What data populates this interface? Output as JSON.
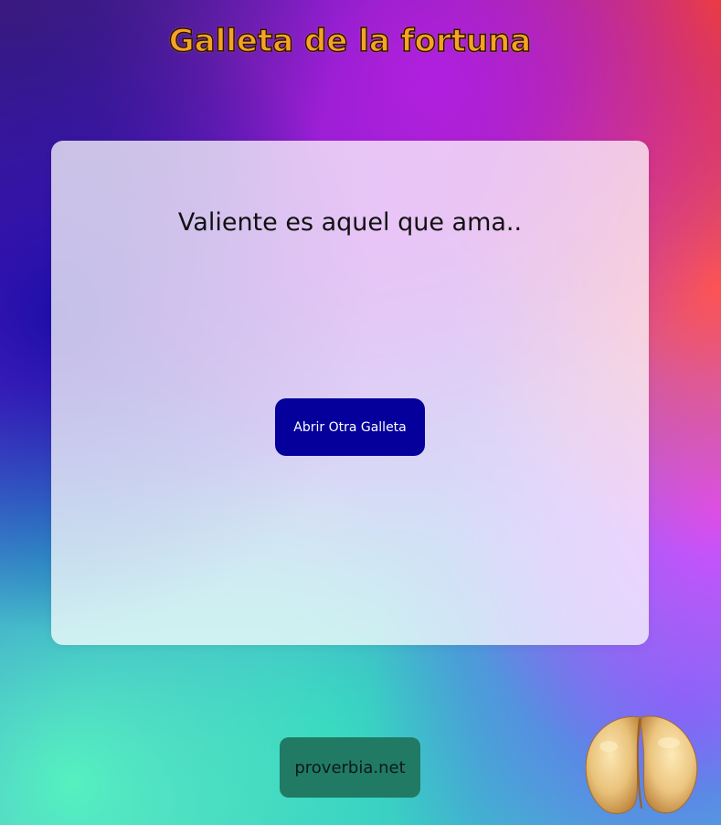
{
  "header": {
    "title": "Galleta de la fortuna"
  },
  "card": {
    "phrase": "Valiente es aquel que ama..",
    "open_button_label": "Abrir Otra Galleta"
  },
  "footer": {
    "source_button_label": "proverbia.net",
    "cookie_image": "fortune-cookie-image"
  },
  "colors": {
    "title": "#f6a323",
    "open_button": "#05009c",
    "source_button": "#207a64"
  }
}
